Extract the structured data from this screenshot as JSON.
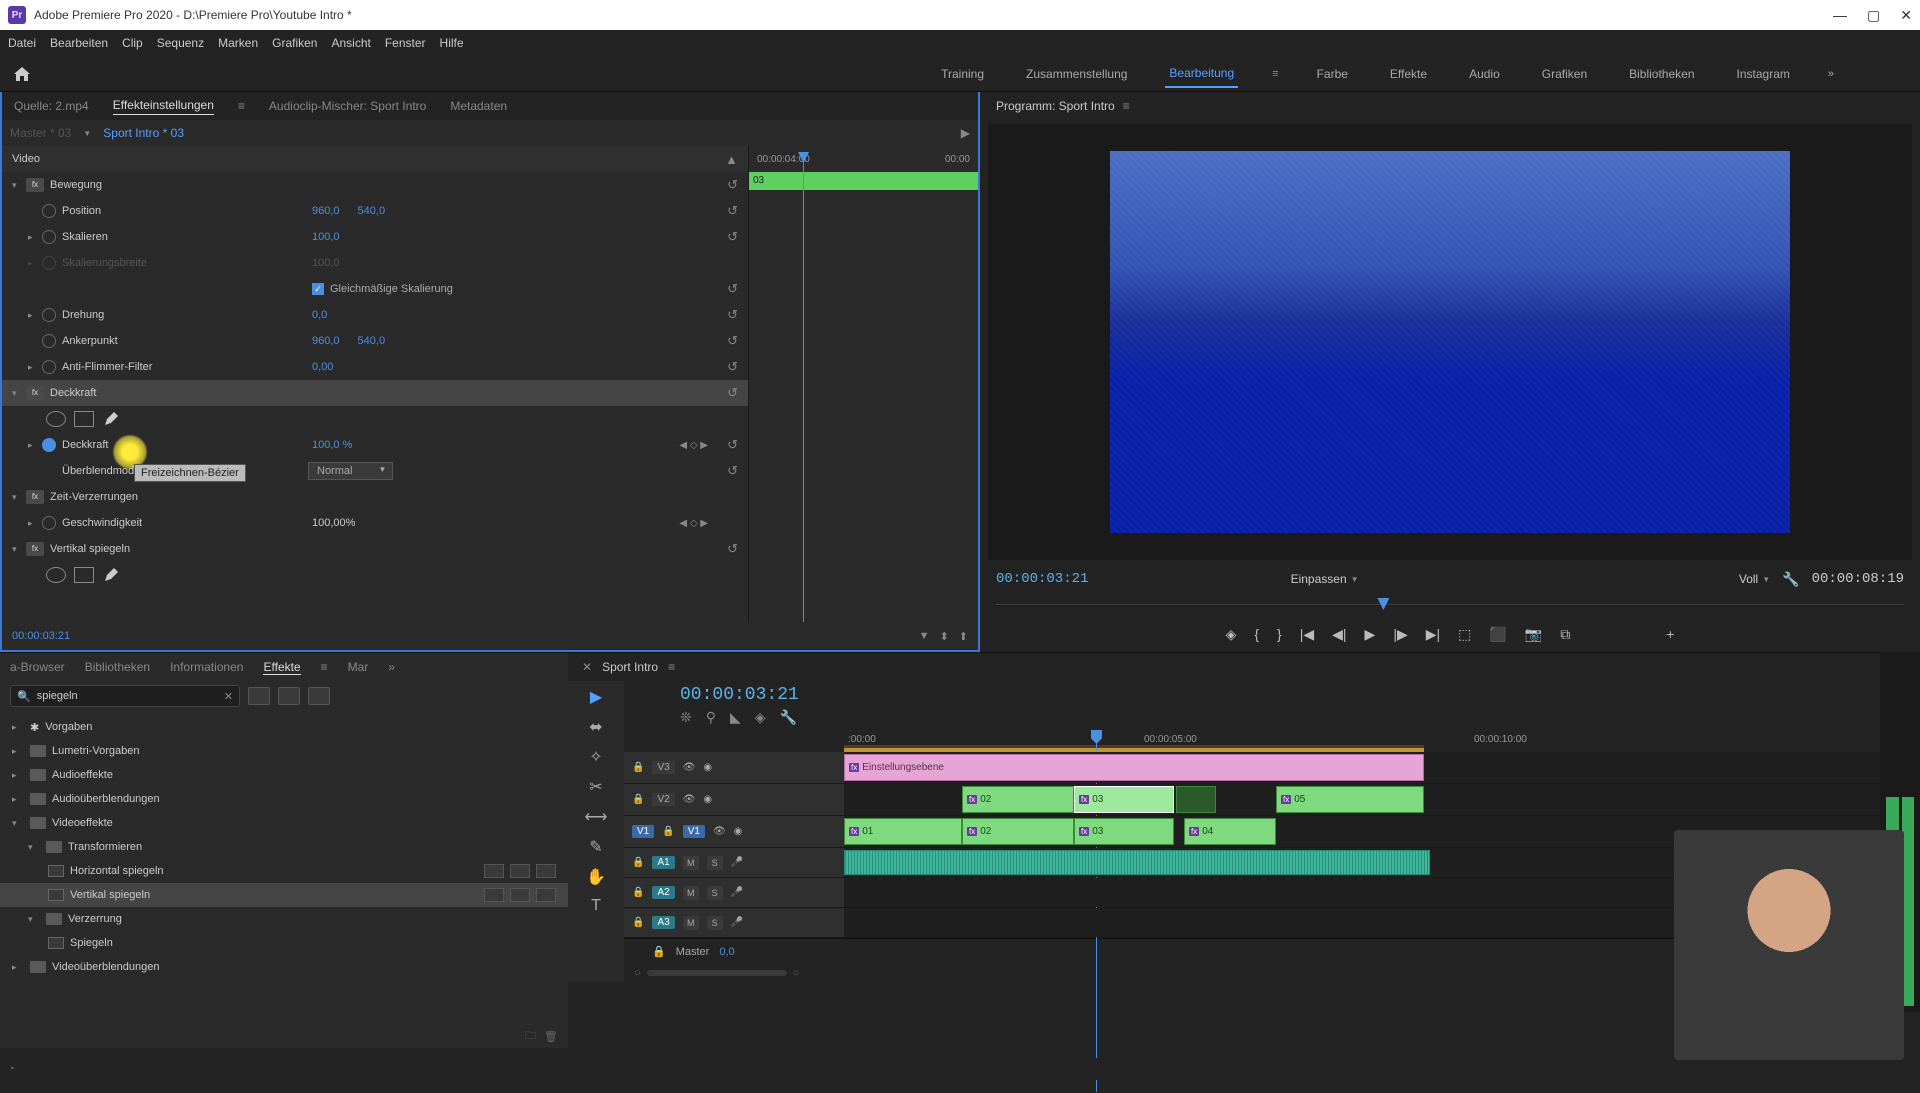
{
  "titlebar": {
    "app": "Pr",
    "title": "Adobe Premiere Pro 2020 - D:\\Premiere Pro\\Youtube Intro *"
  },
  "menu": [
    "Datei",
    "Bearbeiten",
    "Clip",
    "Sequenz",
    "Marken",
    "Grafiken",
    "Ansicht",
    "Fenster",
    "Hilfe"
  ],
  "workspaces": [
    "Training",
    "Zusammenstellung",
    "Bearbeitung",
    "Farbe",
    "Effekte",
    "Audio",
    "Grafiken",
    "Bibliotheken",
    "Instagram"
  ],
  "active_workspace": "Bearbeitung",
  "effect_tabs": {
    "source": "Quelle: 2.mp4",
    "active": "Effekteinstellungen",
    "mixer": "Audioclip-Mischer: Sport Intro",
    "meta": "Metadaten"
  },
  "effect_header": {
    "master": "Master * 03",
    "clip": "Sport Intro * 03"
  },
  "mini_tl": {
    "t1": "00:00:04:00",
    "t2": "00:00",
    "clip": "03"
  },
  "props": {
    "video": "Video",
    "bewegung": "Bewegung",
    "position": "Position",
    "pos_x": "960,0",
    "pos_y": "540,0",
    "skalieren": "Skalieren",
    "skal_v": "100,0",
    "skalbreite": "Skalierungsbreite",
    "skalb_v": "100,0",
    "gleich": "Gleichmäßige Skalierung",
    "drehung": "Drehung",
    "dreh_v": "0,0",
    "anker": "Ankerpunkt",
    "ank_x": "960,0",
    "ank_y": "540,0",
    "antifl": "Anti-Flimmer-Filter",
    "antifl_v": "0,00",
    "deckkraft": "Deckkraft",
    "deckkraft_prop": "Deckkraft",
    "deck_v": "100,0 %",
    "blend": "Überblendmodus",
    "blend_v": "Normal",
    "zeit": "Zeit-Verzerrungen",
    "geschw": "Geschwindigkeit",
    "geschw_v": "100,00%",
    "vspiegeln": "Vertikal spiegeln"
  },
  "tooltip": "Freizeichnen-Bézier",
  "effect_footer_tc": "00:00:03:21",
  "program": {
    "header": "Programm: Sport Intro",
    "tc": "00:00:03:21",
    "fit": "Einpassen",
    "quality": "Voll",
    "duration": "00:00:08:19"
  },
  "browser_tabs": [
    "a-Browser",
    "Bibliotheken",
    "Informationen",
    "Effekte",
    "Mar"
  ],
  "browser_active": "Effekte",
  "search": "spiegeln",
  "tree": {
    "vorgaben": "Vorgaben",
    "lumetri": "Lumetri-Vorgaben",
    "audioeffekte": "Audioeffekte",
    "audioub": "Audioüberblendungen",
    "videoeffekte": "Videoeffekte",
    "transformieren": "Transformieren",
    "hspiegeln": "Horizontal spiegeln",
    "vspiegeln": "Vertikal spiegeln",
    "verzerrung": "Verzerrung",
    "spiegeln": "Spiegeln",
    "videoub": "Videoüberblendungen"
  },
  "timeline": {
    "seq": "Sport Intro",
    "tc": "00:00:03:21",
    "ticks": [
      ":00:00",
      "00:00:05:00",
      "00:00:10:00"
    ],
    "tracks_v": [
      "V3",
      "V2",
      "V1"
    ],
    "tracks_a": [
      "A1",
      "A2",
      "A3"
    ],
    "v1_src": "V1",
    "master": "Master",
    "master_v": "0,0",
    "adj_layer": "Einstellungsebene",
    "clips_v2": [
      "02",
      "03",
      "05"
    ],
    "clips_v1": [
      "01",
      "02",
      "03",
      "04"
    ]
  }
}
